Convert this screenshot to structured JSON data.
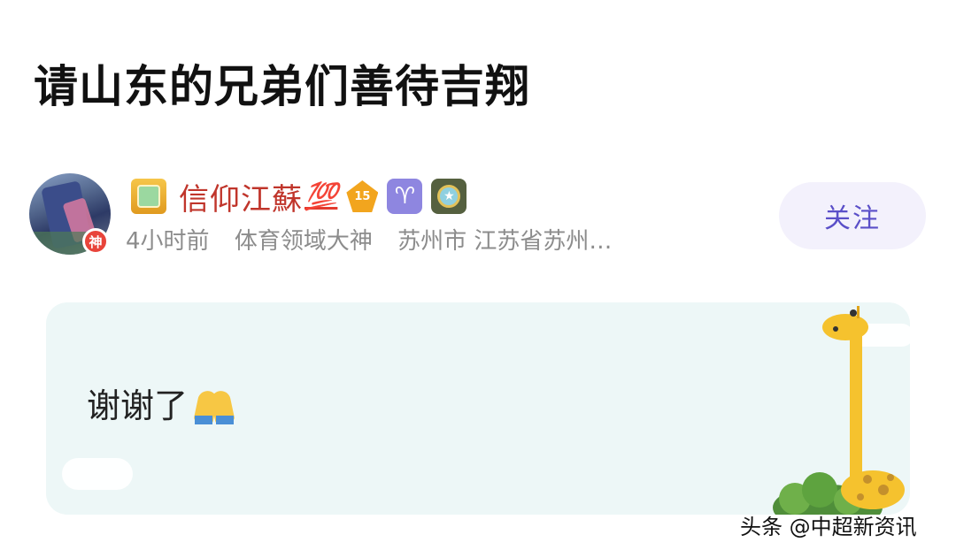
{
  "post": {
    "title": "请山东的兄弟们善待吉翔"
  },
  "author": {
    "avatar_badge": "神",
    "name": "信仰江蘇",
    "name_suffix": "💯",
    "level": "15",
    "zodiac": "♈",
    "time": "4小时前",
    "tag": "体育领域大神",
    "location": "苏州市 江苏省苏州…",
    "follow_label": "关注",
    "colors": {
      "name": "#c0352b",
      "follow_text": "#5a4fc8",
      "follow_bg": "#f3f1fc"
    },
    "icons": [
      "medal-badge-icon",
      "level-diamond-icon",
      "aries-zodiac-icon",
      "star-medal-icon"
    ]
  },
  "message": {
    "text": "谢谢了",
    "emoji_icon": "folded-hands-icon",
    "card_color": "#edf7f7"
  },
  "watermark": "头条 @中超新资讯"
}
